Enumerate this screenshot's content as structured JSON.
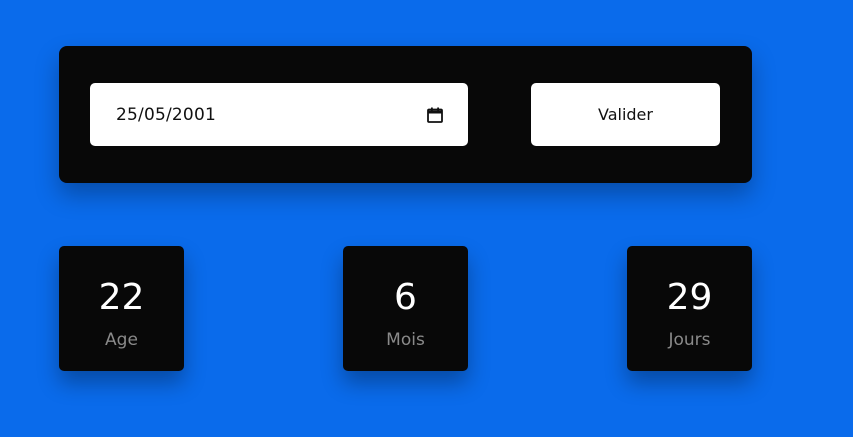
{
  "colors": {
    "background": "#0A6BEB",
    "panel": "#080808",
    "field": "#ffffff",
    "value_text": "#ffffff",
    "label_text": "#8a8a8a"
  },
  "form": {
    "date_value": "25/05/2001",
    "date_icon": "calendar-icon",
    "submit_label": "Valider"
  },
  "results": [
    {
      "value": "22",
      "label": "Age"
    },
    {
      "value": "6",
      "label": "Mois"
    },
    {
      "value": "29",
      "label": "Jours"
    }
  ]
}
